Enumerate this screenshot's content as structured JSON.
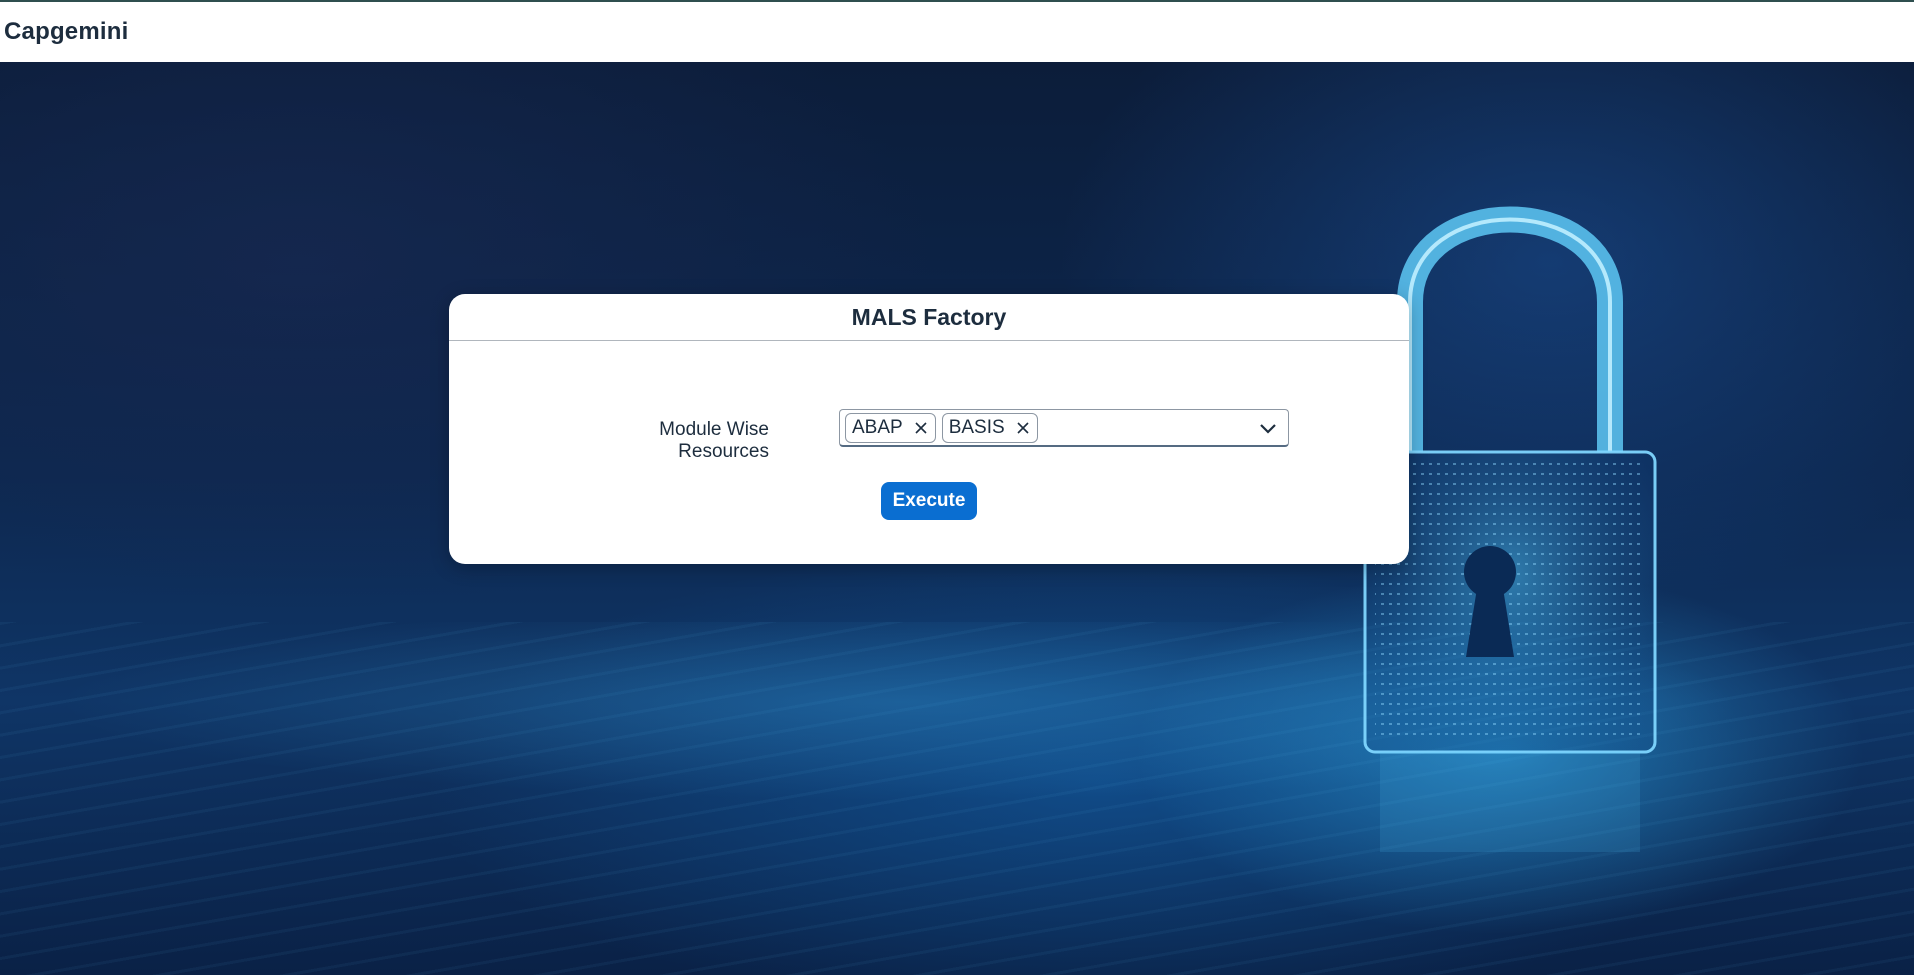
{
  "shell": {
    "brand": "Capgemini"
  },
  "card": {
    "title": "MALS Factory",
    "field_label": "Module Wise Resources",
    "selected_tokens": [
      {
        "label": "ABAP"
      },
      {
        "label": "BASIS"
      }
    ],
    "execute_label": "Execute"
  },
  "icons": {
    "token_remove": "close-icon",
    "dropdown": "chevron-down-icon",
    "background": "padlock-illustration"
  },
  "colors": {
    "accent": "#0a6ed1",
    "text": "#1d2d3e",
    "background": "#0d2850"
  }
}
